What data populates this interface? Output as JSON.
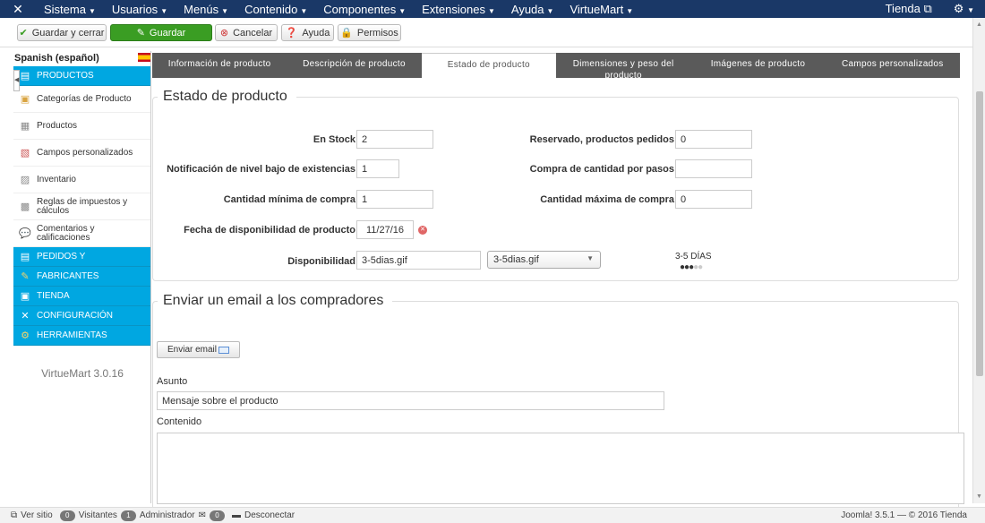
{
  "topnav": {
    "menus": [
      {
        "label": "Sistema"
      },
      {
        "label": "Usuarios"
      },
      {
        "label": "Menús"
      },
      {
        "label": "Contenido"
      },
      {
        "label": "Componentes"
      },
      {
        "label": "Extensiones"
      },
      {
        "label": "Ayuda"
      },
      {
        "label": "VirtueMart"
      }
    ],
    "store_label": "Tienda"
  },
  "toolbar": {
    "save_close": "Guardar y cerrar",
    "save": "Guardar",
    "cancel": "Cancelar",
    "help": "Ayuda",
    "permissions": "Permisos"
  },
  "sidebar": {
    "language": "Spanish (español)",
    "items": [
      {
        "label": "PRODUCTOS",
        "icon": "products-icon"
      },
      {
        "label": "Categorías de Producto",
        "icon": "categories-icon"
      },
      {
        "label": "Productos",
        "icon": "product-icon"
      },
      {
        "label": "Campos personalizados",
        "icon": "custom-fields-icon"
      },
      {
        "label": "Inventario",
        "icon": "inventory-icon"
      },
      {
        "label": "Reglas de impuestos y cálculos",
        "icon": "tax-icon"
      },
      {
        "label": "Comentarios y calificaciones",
        "icon": "comments-icon"
      },
      {
        "label": "PEDIDOS Y",
        "icon": "orders-icon"
      },
      {
        "label": "FABRICANTES",
        "icon": "wrench-icon"
      },
      {
        "label": "TIENDA",
        "icon": "store-icon"
      },
      {
        "label": "CONFIGURACIÓN",
        "icon": "config-icon"
      },
      {
        "label": "HERRAMIENTAS",
        "icon": "tools-icon"
      }
    ],
    "version": "VirtueMart 3.0.16"
  },
  "tabs": [
    {
      "label": "Información de producto"
    },
    {
      "label": "Descripción de producto"
    },
    {
      "label": "Estado de producto"
    },
    {
      "label": "Dimensiones y peso del producto"
    },
    {
      "label": "Imágenes de producto"
    },
    {
      "label": "Campos personalizados"
    }
  ],
  "status_section": {
    "title": "Estado de producto",
    "in_stock_label": "En Stock",
    "in_stock_value": "2",
    "low_stock_label": "Notificación de nivel bajo de existencias",
    "low_stock_value": "1",
    "min_purchase_label": "Cantidad mínima de compra",
    "min_purchase_value": "1",
    "availability_date_label": "Fecha de disponibilidad de producto",
    "availability_date_value": "11/27/16",
    "availability_label": "Disponibilidad",
    "availability_value": "3-5dias.gif",
    "availability_select": "3-5dias.gif",
    "availability_text": "3-5 DÍAS",
    "reserved_label": "Reservado, productos pedidos",
    "reserved_value": "0",
    "step_label": "Compra de cantidad por pasos",
    "step_value": "",
    "max_purchase_label": "Cantidad máxima de compra",
    "max_purchase_value": "0"
  },
  "email_section": {
    "title": "Enviar un email a los compradores",
    "send_button": "Enviar email",
    "subject_label": "Asunto",
    "subject_value": "Mensaje sobre el producto",
    "content_label": "Contenido"
  },
  "statusbar": {
    "view_site": "Ver sitio",
    "visitors_count": "0",
    "visitors_label": "Visitantes",
    "admin_count": "1",
    "admin_label": "Administrador",
    "messages_count": "0",
    "logout": "Desconectar",
    "version_text": "Joomla! 3.5.1 — © 2016 Tienda"
  }
}
